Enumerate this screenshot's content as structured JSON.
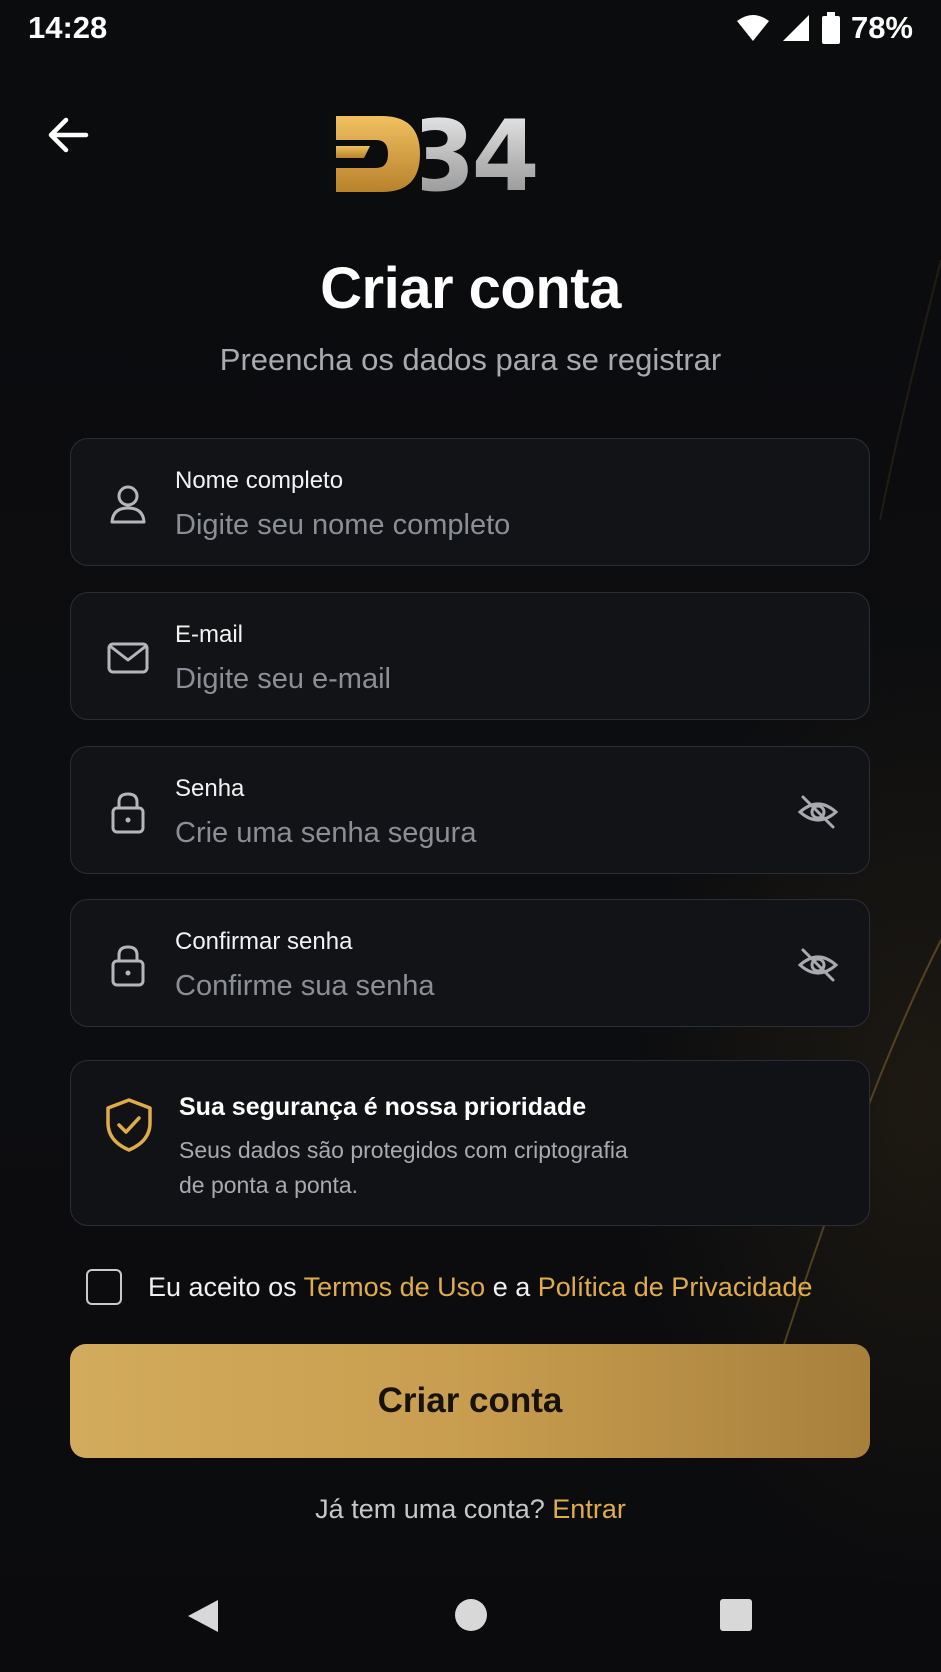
{
  "status_bar": {
    "time": "14:28",
    "battery": "78%"
  },
  "header": {
    "logo_text": "D34"
  },
  "page": {
    "title": "Criar conta",
    "subtitle": "Preencha os dados para se registrar"
  },
  "form": {
    "name": {
      "label": "Nome completo",
      "placeholder": "Digite seu nome completo",
      "value": ""
    },
    "email": {
      "label": "E-mail",
      "placeholder": "Digite seu e-mail",
      "value": ""
    },
    "password": {
      "label": "Senha",
      "placeholder": "Crie uma senha segura",
      "value": ""
    },
    "confirm": {
      "label": "Confirmar senha",
      "placeholder": "Confirme sua senha",
      "value": ""
    }
  },
  "security": {
    "title": "Sua segurança é nossa prioridade",
    "line1": "Seus dados são protegidos com criptografia",
    "line2": "de ponta a ponta."
  },
  "terms": {
    "prefix": "Eu aceito os ",
    "terms_link": "Termos de Uso",
    "middle": " e a ",
    "privacy_link": "Política de Privacidade",
    "checked": false
  },
  "cta": {
    "label": "Criar conta"
  },
  "login": {
    "prompt": "Já tem uma conta? ",
    "link": "Entrar"
  },
  "colors": {
    "accent": "#e0ac48",
    "background": "#0b0c0e",
    "button": "#c89d4f"
  },
  "icons": [
    "arrow-left-icon",
    "user-icon",
    "mail-icon",
    "lock-icon",
    "eye-off-icon",
    "shield-check-icon",
    "wifi-icon",
    "signal-icon",
    "battery-icon"
  ]
}
